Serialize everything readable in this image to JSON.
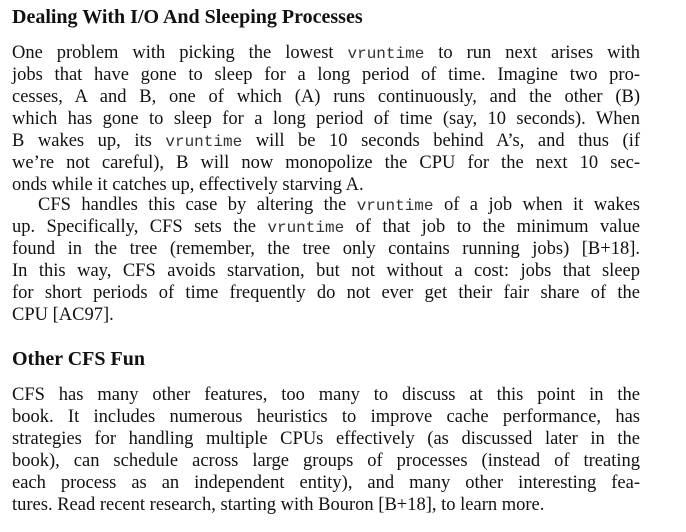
{
  "section1": {
    "heading": "Dealing With I/O And Sleeping Processes",
    "paragraph1": [
      [
        "One problem with picking the lowest ",
        "vruntime",
        " to run next arises with"
      ],
      [
        "jobs that have gone to sleep for a long period of time. Imagine two pro-"
      ],
      [
        "cesses, A and B, one of which (A) runs continuously, and the other (B)"
      ],
      [
        "which has gone to sleep for a long period of time (say, 10 seconds). When"
      ],
      [
        "B wakes up, its ",
        "vruntime",
        " will be 10 seconds behind A’s, and thus (if"
      ],
      [
        "we’re not careful), B will now monopolize the CPU for the next 10 sec-"
      ],
      [
        "onds while it catches up, effectively starving A."
      ]
    ],
    "paragraph2": [
      [
        "CFS handles this case by altering the ",
        "vruntime",
        " of a job when it wakes"
      ],
      [
        "up. Specifically, CFS sets the ",
        "vruntime",
        " of that job to the minimum value"
      ],
      [
        "found in the tree (remember, the tree only contains running jobs) [B+18]."
      ],
      [
        "In this way, CFS avoids starvation, but not without a cost: jobs that sleep"
      ],
      [
        "for short periods of time frequently do not ever get their fair share of the"
      ],
      [
        "CPU [AC97]."
      ]
    ]
  },
  "section2": {
    "heading": "Other CFS Fun",
    "paragraph1": [
      [
        "CFS has many other features, too many to discuss at this point in the"
      ],
      [
        "book. It includes numerous heuristics to improve cache performance, has"
      ],
      [
        "strategies for handling multiple CPUs effectively (as discussed later in the"
      ],
      [
        "book), can schedule across large groups of processes (instead of treating"
      ],
      [
        "each process as an independent entity), and many other interesting fea-"
      ],
      [
        "tures. Read recent research, starting with Bouron [B+18], to learn more."
      ]
    ]
  }
}
